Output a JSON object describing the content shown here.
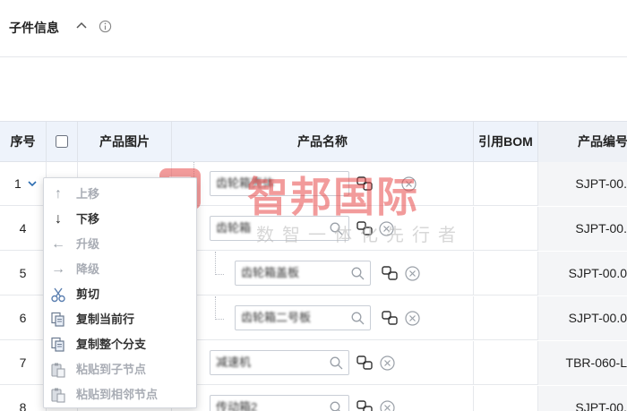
{
  "section": {
    "title": "子件信息",
    "collapse_icon": "chevron-up-icon",
    "info_icon": "info-circle-icon"
  },
  "table": {
    "columns": [
      "序号",
      "",
      "产品图片",
      "产品名称",
      "引用BOM",
      "产品编号"
    ],
    "rows": [
      {
        "seq": "1",
        "name": "齿轮箱壳体",
        "code": "SJPT-00.",
        "expanded": true,
        "level": 0
      },
      {
        "seq": "4",
        "name": "齿轮箱",
        "code": "SJPT-00.",
        "level": 0
      },
      {
        "seq": "5",
        "name": "齿轮箱盖板",
        "code": "SJPT-00.0",
        "level": 1
      },
      {
        "seq": "6",
        "name": "齿轮箱二号板",
        "code": "SJPT-00.0",
        "level": 1
      },
      {
        "seq": "7",
        "name": "减速机",
        "code": "TBR-060-L",
        "level": 0
      },
      {
        "seq": "8",
        "name": "传动箱2",
        "code": "SJPT-00.",
        "level": 0
      }
    ]
  },
  "context_menu": {
    "items": [
      {
        "label": "上移",
        "icon": "arrow-up-icon",
        "disabled": true
      },
      {
        "label": "下移",
        "icon": "arrow-down-icon",
        "disabled": false
      },
      {
        "label": "升级",
        "icon": "arrow-left-icon",
        "disabled": true
      },
      {
        "label": "降级",
        "icon": "arrow-right-icon",
        "disabled": true
      },
      {
        "label": "剪切",
        "icon": "scissors-icon",
        "disabled": false
      },
      {
        "label": "复制当前行",
        "icon": "copy-icon",
        "disabled": false
      },
      {
        "label": "复制整个分支",
        "icon": "copy-icon",
        "disabled": false
      },
      {
        "label": "粘贴到子节点",
        "icon": "paste-icon",
        "disabled": true
      },
      {
        "label": "粘贴到相邻节点",
        "icon": "paste-icon",
        "disabled": true
      }
    ]
  },
  "watermark": {
    "logo": "zhibang-logo",
    "brand": "智邦国际",
    "slogan": "数智一体化先行者"
  },
  "colors": {
    "header_bg": "#eef3fb",
    "code_col_bg": "#f4f5f7",
    "brand_red": "#e84a4a",
    "border": "#e6e8ec"
  }
}
